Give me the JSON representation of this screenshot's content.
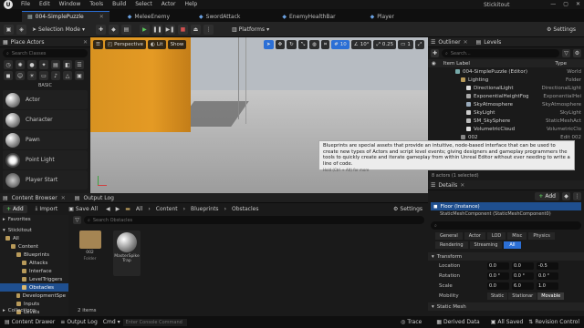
{
  "menu": {
    "items": [
      "File",
      "Edit",
      "Window",
      "Tools",
      "Build",
      "Select",
      "Actor",
      "Help"
    ],
    "project_name": "Stickitout"
  },
  "tabs": [
    {
      "label": "004-SimplePuzzle",
      "active": true
    },
    {
      "label": "MeleeEnemy",
      "active": false
    },
    {
      "label": "SwordAttack",
      "active": false
    },
    {
      "label": "EnemyHealthBar",
      "active": false
    },
    {
      "label": "Player",
      "active": false
    }
  ],
  "toolbar": {
    "selection_mode": "Selection Mode",
    "platforms": "Platforms",
    "settings": "Settings"
  },
  "place_actors": {
    "title": "Place Actors",
    "search_placeholder": "Search Classes",
    "category_label": "BASIC",
    "items": [
      "Actor",
      "Character",
      "Pawn",
      "Point Light",
      "Player Start"
    ]
  },
  "viewport": {
    "perspective": "Perspective",
    "lit": "Lit",
    "show": "Show",
    "grid_snap": "10",
    "angle_snap": "10°",
    "scale_snap": "0.25",
    "camera_speed": "1"
  },
  "outliner": {
    "tabs": [
      "Outliner",
      "Levels"
    ],
    "search_placeholder": "Search...",
    "col_label": "Item Label",
    "col_type": "Type",
    "rows": [
      {
        "label": "004-SimplePuzzle (Editor)",
        "type": "World",
        "indent": 0
      },
      {
        "label": "Lighting",
        "type": "Folder",
        "indent": 1
      },
      {
        "label": "DirectionalLight",
        "type": "DirectionalLight",
        "indent": 2
      },
      {
        "label": "ExponentialHeightFog",
        "type": "ExponentialHei",
        "indent": 2
      },
      {
        "label": "SkyAtmosphere",
        "type": "SkyAtmosphere",
        "indent": 2
      },
      {
        "label": "SkyLight",
        "type": "SkyLight",
        "indent": 2
      },
      {
        "label": "SM_SkySphere",
        "type": "StaticMeshAct",
        "indent": 2
      },
      {
        "label": "VolumetricCloud",
        "type": "VolumetricClo",
        "indent": 2
      },
      {
        "label": "002",
        "type": "Edit 002",
        "indent": 1
      }
    ],
    "footer": "8 actors (1 selected)"
  },
  "tooltip": {
    "text": "Blueprints are special assets that provide an intuitive, node-based interface that can be used to create new types of Actors and script level events; giving designers and gameplay programmers the tools to quickly create and iterate gameplay from within Unreal Editor without ever needing to write a line of code.",
    "hint": "Hold (Ctrl + Alt) for more"
  },
  "details": {
    "title": "Details",
    "add_label": "Add",
    "selected": "Floor (Instance)",
    "component": "StaticMeshComponent (StaticMeshComponent0)",
    "filters_row1": [
      "General",
      "Actor",
      "LOD",
      "Misc",
      "Physics"
    ],
    "filters_row2": [
      "Rendering",
      "Streaming",
      "All"
    ],
    "section": "Transform",
    "location": {
      "label": "Location",
      "x": "0.0",
      "y": "0.0",
      "z": "-0.5"
    },
    "rotation": {
      "label": "Rotation",
      "x": "0.0 °",
      "y": "0.0 °",
      "z": "0.0 °"
    },
    "scale": {
      "label": "Scale",
      "x": "0.0",
      "y": "6.0",
      "z": "1.0"
    },
    "mobility": {
      "label": "Mobility",
      "options": [
        "Static",
        "Stationar",
        "Movable"
      ],
      "selected": "Movable"
    },
    "next_section": "Static Mesh"
  },
  "content_browser": {
    "tabs": [
      "Content Browser",
      "Output Log"
    ],
    "add_label": "Add",
    "import_label": "Import",
    "save_all_label": "Save All",
    "breadcrumb": [
      "All",
      "Content",
      "Blueprints",
      "Obstacles"
    ],
    "settings": "Settings",
    "favorites": "Favorites",
    "project": "Stickitout",
    "tree": [
      {
        "label": "All",
        "indent": 0
      },
      {
        "label": "Content",
        "indent": 1
      },
      {
        "label": "Blueprints",
        "indent": 2
      },
      {
        "label": "Attacks",
        "indent": 3
      },
      {
        "label": "Interface",
        "indent": 3
      },
      {
        "label": "LevelTriggers",
        "indent": 3
      },
      {
        "label": "Obstacles",
        "indent": 3,
        "selected": true
      },
      {
        "label": "DevelopmentSpe",
        "indent": 2
      },
      {
        "label": "Inputs",
        "indent": 2
      },
      {
        "label": "Levels",
        "indent": 2
      }
    ],
    "search_placeholder": "Search Obstacles",
    "assets": [
      {
        "name": "002",
        "kind": "Folder"
      },
      {
        "name": "MasterSpike Trap",
        "kind": "Blueprint"
      }
    ],
    "count": "2 items",
    "collections": "Collections"
  },
  "status": {
    "content_drawer": "Content Drawer",
    "output_log": "Output Log",
    "cmd": "Cmd",
    "console_placeholder": "Enter Console Command",
    "trace": "Trace",
    "derived_data": "Derived Data",
    "all_saved": "All Saved",
    "revision_control": "Revision Control"
  },
  "colors": {
    "accent_blue": "#2b6fd6",
    "play_green": "#5bc85b",
    "cube_orange": "#e49a24",
    "tree_selected": "#1f4f8f"
  },
  "icons": [
    "unreal-logo-icon",
    "play-icon",
    "pause-icon",
    "stop-icon",
    "settings-gear-icon",
    "search-icon",
    "filter-icon",
    "folder-icon",
    "eye-icon"
  ]
}
